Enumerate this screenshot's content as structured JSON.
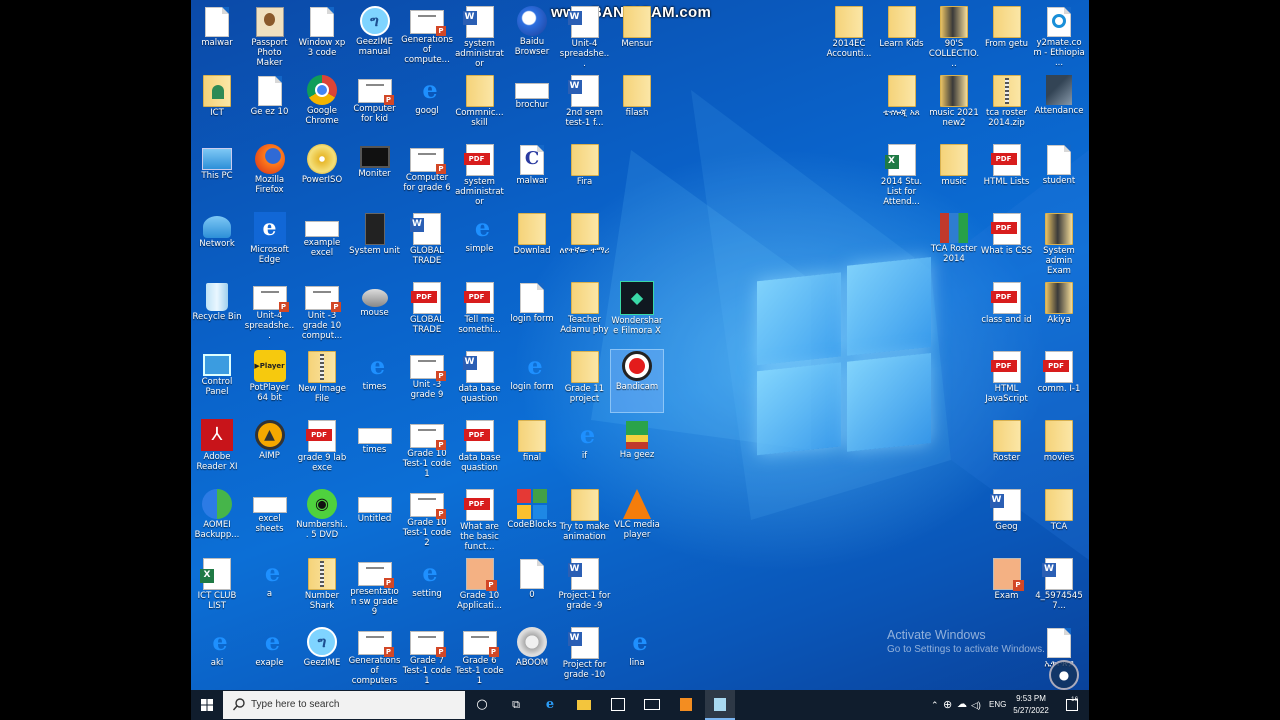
{
  "watermark": "www.BANDICAM.com",
  "activate": {
    "title": "Activate Windows",
    "subtitle": "Go to Settings to activate Windows."
  },
  "taskbar": {
    "search_placeholder": "Type here to search",
    "language": "ENG",
    "time": "9:53 PM",
    "date": "5/27/2022",
    "notification_count": "16"
  },
  "colors": {
    "desktop": "#0a62c9",
    "taskbar": "#101d2d",
    "pdf": "#d81d1d",
    "word": "#2b5fb4"
  },
  "icons": [
    {
      "label": "malwar",
      "kind": "file",
      "col": 0,
      "row": 0
    },
    {
      "label": "Passport Photo Maker",
      "kind": "photo",
      "col": 1,
      "row": 0
    },
    {
      "label": "Window xp 3 code",
      "kind": "file",
      "col": 2,
      "row": 0
    },
    {
      "label": "GeezIME manual",
      "kind": "geez",
      "col": 3,
      "row": 0
    },
    {
      "label": "Generations of compute...",
      "kind": "pptwide",
      "col": 4,
      "row": 0
    },
    {
      "label": "system administrator",
      "kind": "word",
      "col": 5,
      "row": 0
    },
    {
      "label": "Baidu Browser",
      "kind": "baidu",
      "col": 6,
      "row": 0
    },
    {
      "label": "Unit-4 spreadshe...",
      "kind": "word",
      "col": 7,
      "row": 0
    },
    {
      "label": "Mensur",
      "kind": "folder",
      "col": 8,
      "row": 0
    },
    {
      "label": "ICT",
      "kind": "folderuser",
      "col": 0,
      "row": 1
    },
    {
      "label": "Ge ez 10",
      "kind": "file",
      "col": 1,
      "row": 1
    },
    {
      "label": "Google Chrome",
      "kind": "chrome",
      "col": 2,
      "row": 1
    },
    {
      "label": "Computer for kid",
      "kind": "pptwide",
      "col": 3,
      "row": 1
    },
    {
      "label": "googl",
      "kind": "ie",
      "col": 4,
      "row": 1
    },
    {
      "label": "Commnic... skill",
      "kind": "folder",
      "col": 5,
      "row": 1
    },
    {
      "label": "brochur",
      "kind": "docwide",
      "col": 6,
      "row": 1
    },
    {
      "label": "2nd sem test-1 f...",
      "kind": "word",
      "col": 7,
      "row": 1
    },
    {
      "label": "filash",
      "kind": "folder",
      "col": 8,
      "row": 1
    },
    {
      "label": "This PC",
      "kind": "pc",
      "col": 0,
      "row": 2
    },
    {
      "label": "Mozilla Firefox",
      "kind": "firefox",
      "col": 1,
      "row": 2
    },
    {
      "label": "PowerISO",
      "kind": "poweriso",
      "col": 2,
      "row": 2
    },
    {
      "label": "Moniter",
      "kind": "monitor",
      "col": 3,
      "row": 2
    },
    {
      "label": "Computer for grade 6",
      "kind": "pptwide",
      "col": 4,
      "row": 2
    },
    {
      "label": "system administrator",
      "kind": "pdf",
      "col": 5,
      "row": 2
    },
    {
      "label": "malwar",
      "kind": "cfile",
      "col": 6,
      "row": 2
    },
    {
      "label": "Fira",
      "kind": "folder",
      "col": 7,
      "row": 2
    },
    {
      "label": "Network",
      "kind": "network",
      "col": 0,
      "row": 3
    },
    {
      "label": "Microsoft Edge",
      "kind": "edge",
      "col": 1,
      "row": 3
    },
    {
      "label": "example excel",
      "kind": "docwide",
      "col": 2,
      "row": 3
    },
    {
      "label": "System unit",
      "kind": "tower",
      "col": 3,
      "row": 3
    },
    {
      "label": "GLOBAL TRADE",
      "kind": "word",
      "col": 4,
      "row": 3
    },
    {
      "label": "simple",
      "kind": "ie",
      "col": 5,
      "row": 3
    },
    {
      "label": "Downlad",
      "kind": "folder",
      "col": 6,
      "row": 3
    },
    {
      "label": "ለየትኛው ተማሪ",
      "kind": "folder",
      "col": 7,
      "row": 3
    },
    {
      "label": "Recycle Bin",
      "kind": "recycle",
      "col": 0,
      "row": 4
    },
    {
      "label": "Unit-4 spreadshe...",
      "kind": "pptwide",
      "col": 1,
      "row": 4
    },
    {
      "label": "Unit -3 grade 10 comput...",
      "kind": "pptwide",
      "col": 2,
      "row": 4
    },
    {
      "label": "mouse",
      "kind": "mouse",
      "col": 3,
      "row": 4
    },
    {
      "label": "GLOBAL TRADE",
      "kind": "pdf",
      "col": 4,
      "row": 4
    },
    {
      "label": "Tell me somethi...",
      "kind": "pdf",
      "col": 5,
      "row": 4
    },
    {
      "label": "login form",
      "kind": "file",
      "col": 6,
      "row": 4
    },
    {
      "label": "Teacher Adamu phy",
      "kind": "folder",
      "col": 7,
      "row": 4
    },
    {
      "label": "Wondershare Filmora X",
      "kind": "filmora",
      "col": 8,
      "row": 4
    },
    {
      "label": "Control Panel",
      "kind": "control",
      "col": 0,
      "row": 5
    },
    {
      "label": "PotPlayer 64 bit",
      "kind": "potplayer",
      "col": 1,
      "row": 5
    },
    {
      "label": "New Image File",
      "kind": "zip",
      "col": 2,
      "row": 5
    },
    {
      "label": "times",
      "kind": "ie",
      "col": 3,
      "row": 5
    },
    {
      "label": "Unit -3 grade 9",
      "kind": "pptwide",
      "col": 4,
      "row": 5
    },
    {
      "label": "data base quastion",
      "kind": "word",
      "col": 5,
      "row": 5
    },
    {
      "label": "login form",
      "kind": "ie",
      "col": 6,
      "row": 5
    },
    {
      "label": "Grade 11 project",
      "kind": "folder",
      "col": 7,
      "row": 5
    },
    {
      "label": "Bandicam",
      "kind": "bandicam",
      "col": 8,
      "row": 5,
      "selected": true
    },
    {
      "label": "Adobe Reader XI",
      "kind": "adobe",
      "col": 0,
      "row": 6
    },
    {
      "label": "AIMP",
      "kind": "aimp",
      "col": 1,
      "row": 6
    },
    {
      "label": "grade 9 lab exce",
      "kind": "pdf",
      "col": 2,
      "row": 6
    },
    {
      "label": "times",
      "kind": "docwide",
      "col": 3,
      "row": 6
    },
    {
      "label": "Grade 10 Test-1 code 1",
      "kind": "pptwide",
      "col": 4,
      "row": 6
    },
    {
      "label": "data base quastion",
      "kind": "pdf",
      "col": 5,
      "row": 6
    },
    {
      "label": "final",
      "kind": "folder",
      "col": 6,
      "row": 6
    },
    {
      "label": "if",
      "kind": "ie",
      "col": 7,
      "row": 6
    },
    {
      "label": "Ha geez",
      "kind": "hageez",
      "col": 8,
      "row": 6
    },
    {
      "label": "AOMEI Backupp...",
      "kind": "aomei",
      "col": 0,
      "row": 7
    },
    {
      "label": "excel sheets",
      "kind": "docwide",
      "col": 1,
      "row": 7
    },
    {
      "label": "Numbershi... 5 DVD",
      "kind": "monster",
      "col": 2,
      "row": 7
    },
    {
      "label": "Untitled",
      "kind": "docwide",
      "col": 3,
      "row": 7
    },
    {
      "label": "Grade 10 Test-1 code 2",
      "kind": "pptwide",
      "col": 4,
      "row": 7
    },
    {
      "label": "What are the basic funct...",
      "kind": "pdf",
      "col": 5,
      "row": 7
    },
    {
      "label": "CodeBlocks",
      "kind": "codeblocks",
      "col": 6,
      "row": 7
    },
    {
      "label": "Try to make animation",
      "kind": "folder",
      "col": 7,
      "row": 7
    },
    {
      "label": "VLC media player",
      "kind": "vlc",
      "col": 8,
      "row": 7
    },
    {
      "label": "ICT CLUB LIST",
      "kind": "excel",
      "col": 0,
      "row": 8
    },
    {
      "label": "a",
      "kind": "ie",
      "col": 1,
      "row": 8
    },
    {
      "label": "Number Shark",
      "kind": "zip",
      "col": 2,
      "row": 8
    },
    {
      "label": "presentation sw grade 9",
      "kind": "pptwide",
      "col": 3,
      "row": 8
    },
    {
      "label": "setting",
      "kind": "ie",
      "col": 4,
      "row": 8
    },
    {
      "label": "Grade 10 Applicati...",
      "kind": "ppt",
      "col": 5,
      "row": 8
    },
    {
      "label": "0",
      "kind": "file",
      "col": 6,
      "row": 8
    },
    {
      "label": "Project-1 for grade -9",
      "kind": "word",
      "col": 7,
      "row": 8
    },
    {
      "label": "aki",
      "kind": "ie",
      "col": 0,
      "row": 9
    },
    {
      "label": "exaple",
      "kind": "ie",
      "col": 1,
      "row": 9
    },
    {
      "label": "GeezIME",
      "kind": "geez",
      "col": 2,
      "row": 9
    },
    {
      "label": "Generations of computers",
      "kind": "pptwide",
      "col": 3,
      "row": 9
    },
    {
      "label": "Grade 7 Test-1 code 1",
      "kind": "pptwide",
      "col": 4,
      "row": 9
    },
    {
      "label": "Grade 6 Test-1 code 1",
      "kind": "pptwide",
      "col": 5,
      "row": 9
    },
    {
      "label": "ABOOM",
      "kind": "aboom",
      "col": 6,
      "row": 9
    },
    {
      "label": "Project for grade -10",
      "kind": "word",
      "col": 7,
      "row": 9
    },
    {
      "label": "lina",
      "kind": "ie",
      "col": 8,
      "row": 9
    }
  ],
  "right_icons": [
    {
      "label": "2014EC Accounti...",
      "kind": "folder",
      "col": 0,
      "row": 0
    },
    {
      "label": "Learn Kids",
      "kind": "folder",
      "col": 1,
      "row": 0
    },
    {
      "label": "90'S COLLECTIO...",
      "kind": "folderdark",
      "col": 2,
      "row": 0
    },
    {
      "label": "From getu",
      "kind": "folder",
      "col": 3,
      "row": 0
    },
    {
      "label": "y2mate.com - Ethiopia ...",
      "kind": "y2mate",
      "col": 4,
      "row": 0
    },
    {
      "label": "ቴኖሎጂ አጸ",
      "kind": "folder",
      "col": 1,
      "row": 1
    },
    {
      "label": "music 2021 new2",
      "kind": "folderdark",
      "col": 2,
      "row": 1
    },
    {
      "label": "tca roster 2014.zip",
      "kind": "zip",
      "col": 3,
      "row": 1
    },
    {
      "label": "Attendance",
      "kind": "attendance",
      "col": 4,
      "row": 1
    },
    {
      "label": "2014 Stu. List for Attend...",
      "kind": "excel",
      "col": 1,
      "row": 2
    },
    {
      "label": "music",
      "kind": "folder",
      "col": 2,
      "row": 2
    },
    {
      "label": "HTML Lists",
      "kind": "pdf",
      "col": 3,
      "row": 2
    },
    {
      "label": "student",
      "kind": "file",
      "col": 4,
      "row": 2
    },
    {
      "label": "TCA Roster 2014",
      "kind": "winrar",
      "col": 2,
      "row": 3
    },
    {
      "label": "What is CSS",
      "kind": "pdf",
      "col": 3,
      "row": 3
    },
    {
      "label": "System admin Exam",
      "kind": "folderdark",
      "col": 4,
      "row": 3
    },
    {
      "label": "class and id",
      "kind": "pdf",
      "col": 3,
      "row": 4
    },
    {
      "label": "Akiya",
      "kind": "folderdark",
      "col": 4,
      "row": 4
    },
    {
      "label": "HTML JavaScript",
      "kind": "pdf",
      "col": 3,
      "row": 5
    },
    {
      "label": "comm. I-1",
      "kind": "pdf",
      "col": 4,
      "row": 5
    },
    {
      "label": "Roster",
      "kind": "folder",
      "col": 3,
      "row": 6
    },
    {
      "label": "movies",
      "kind": "folderplain",
      "col": 4,
      "row": 6
    },
    {
      "label": "Geog",
      "kind": "word",
      "col": 3,
      "row": 7
    },
    {
      "label": "TCA",
      "kind": "folder",
      "col": 4,
      "row": 7
    },
    {
      "label": "Exam",
      "kind": "ppt",
      "col": 3,
      "row": 8
    },
    {
      "label": "4_59745457...",
      "kind": "word",
      "col": 4,
      "row": 8
    },
    {
      "label": "ኢትዮጵያ",
      "kind": "file",
      "col": 4,
      "row": 9
    }
  ]
}
